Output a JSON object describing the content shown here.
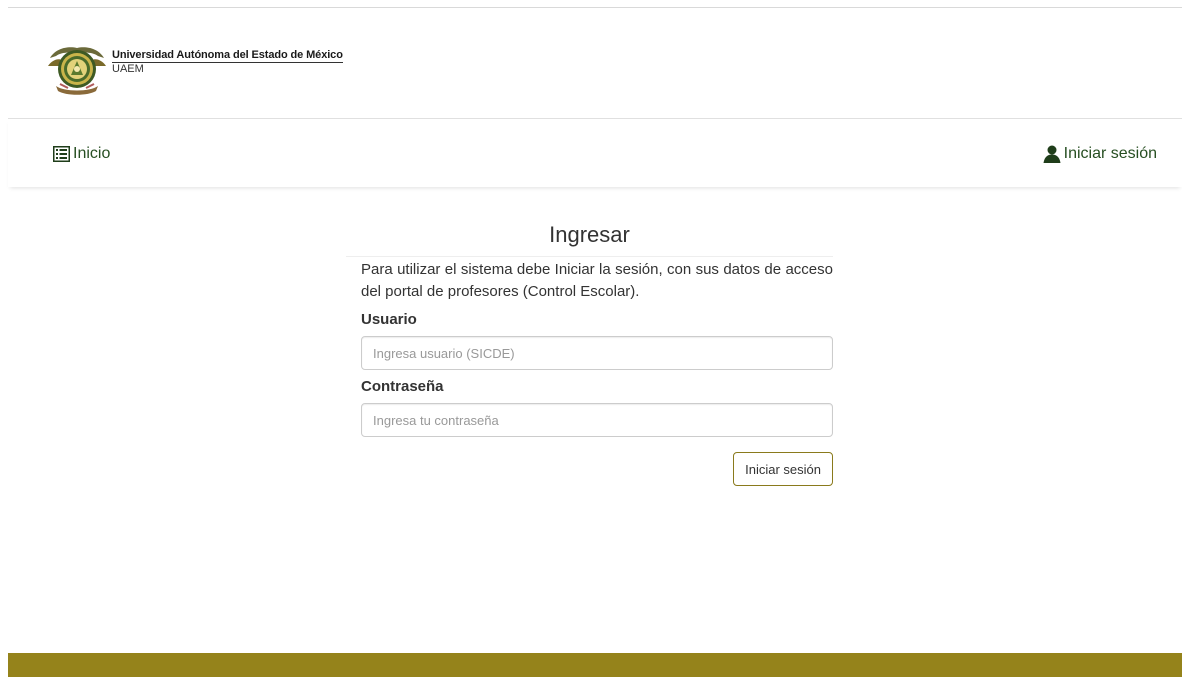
{
  "header": {
    "university_name": "Universidad Autónoma del Estado de México",
    "university_abbr": "UAEM",
    "logo_icon": "university-crest-icon"
  },
  "nav": {
    "home": {
      "label": "Inicio",
      "icon": "list-icon"
    },
    "login": {
      "label": "Iniciar sesión",
      "icon": "user-icon"
    }
  },
  "login_panel": {
    "title": "Ingresar",
    "intro": "Para utilizar el sistema debe Iniciar la sesión, con sus datos de acceso del portal de profesores (Control Escolar).",
    "username": {
      "label": "Usuario",
      "value": "",
      "placeholder": "Ingresa usuario (SICDE)"
    },
    "password": {
      "label": "Contraseña",
      "value": "",
      "placeholder": "Ingresa tu contraseña"
    },
    "submit_label": "Iniciar sesión"
  },
  "colors": {
    "brand_green": "#274f22",
    "footer_gold": "#95831b",
    "button_border": "#8a7a1c"
  }
}
